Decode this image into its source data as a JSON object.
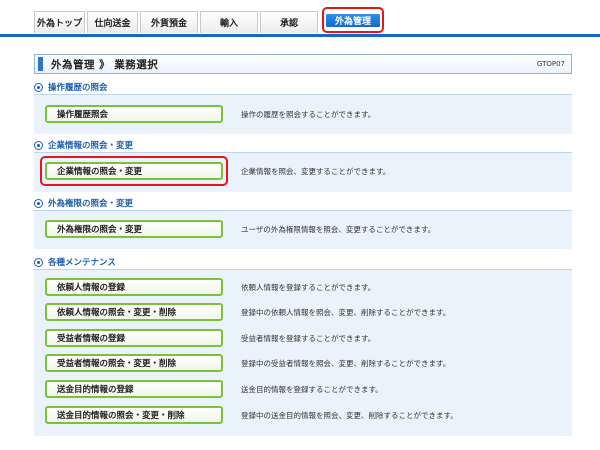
{
  "tabs": [
    "外為トップ",
    "仕向送金",
    "外貨預金",
    "輸入",
    "承認",
    "外為管理"
  ],
  "title": "外為管理 》 業務選択",
  "screen_code": "GTOP07",
  "sections": [
    {
      "heading": "操作履歴の照会",
      "items": [
        {
          "label": "操作履歴照会",
          "desc": "操作の履歴を照会することができます。"
        }
      ]
    },
    {
      "heading": "企業情報の照会・変更",
      "items": [
        {
          "label": "企業情報の照会・変更",
          "desc": "企業情報を照会、変更することができます。"
        }
      ]
    },
    {
      "heading": "外為権限の照会・変更",
      "items": [
        {
          "label": "外為権限の照会・変更",
          "desc": "ユーザの外為権限情報を照会、変更することができます。"
        }
      ]
    },
    {
      "heading": "各種メンテナンス",
      "items": [
        {
          "label": "依頼人情報の登録",
          "desc": "依頼人情報を登録することができます。"
        },
        {
          "label": "依頼人情報の照会・変更・削除",
          "desc": "登録中の依頼人情報を照会、変更、削除することができます。"
        },
        {
          "label": "受益者情報の登録",
          "desc": "受益者情報を登録することができます。"
        },
        {
          "label": "受益者情報の照会・変更・削除",
          "desc": "登録中の受益者情報を照会、変更、削除することができます。"
        },
        {
          "label": "送金目的情報の登録",
          "desc": "送金目的情報を登録することができます。"
        },
        {
          "label": "送金目的情報の照会・変更・削除",
          "desc": "登録中の送金目的情報を照会、変更、削除することができます。"
        }
      ]
    }
  ],
  "colors": {
    "accent": "#1469c8",
    "highlight": "#e8141c",
    "button_border": "#7cc13a",
    "panel_bg": "#eaf3fb"
  }
}
